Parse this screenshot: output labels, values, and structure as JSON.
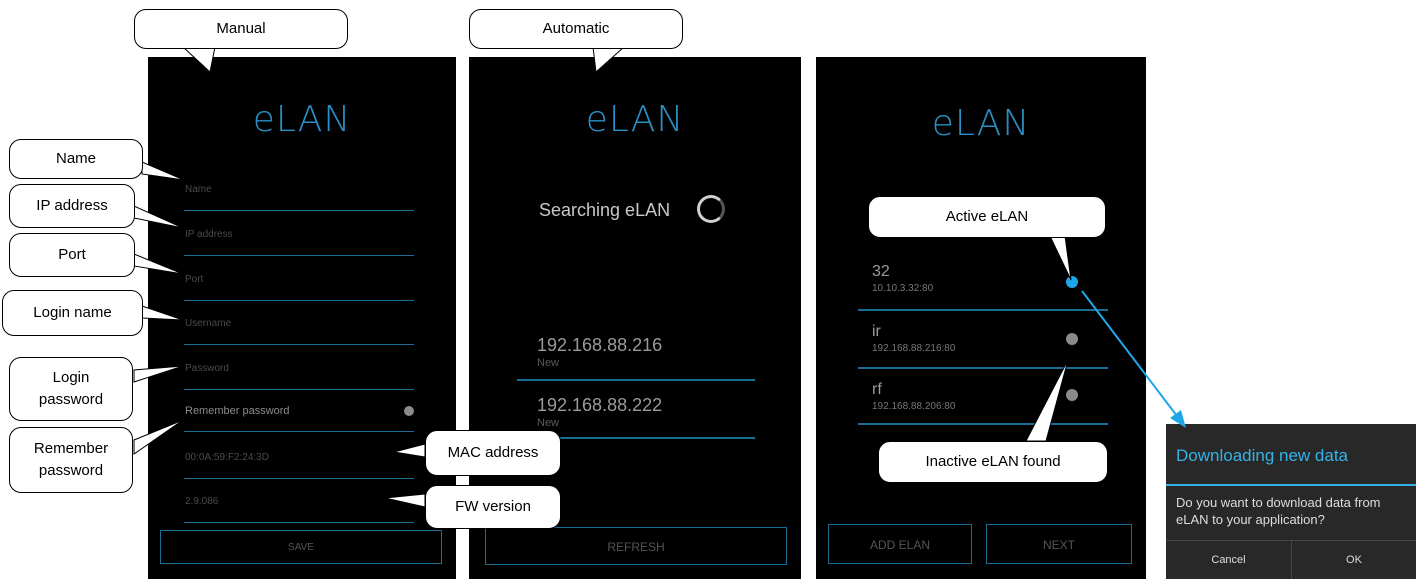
{
  "manual": {
    "logo": "eLAN",
    "fields": [
      "Name",
      "IP address",
      "Port",
      "Username",
      "Password"
    ],
    "remember_label": "Remember password",
    "mac_value": "00:0A:59:F2:24:3D",
    "fw_value": "2.9.086",
    "save_label": "SAVE"
  },
  "automatic": {
    "logo": "eLAN",
    "searching_text": "Searching eLAN",
    "results": [
      {
        "ip": "192.168.88.216",
        "status": "New"
      },
      {
        "ip": "192.168.88.222",
        "status": "New"
      }
    ],
    "refresh_label": "REFRESH"
  },
  "list": {
    "logo": "eLAN",
    "items": [
      {
        "name": "32",
        "address": "10.10.3.32:80",
        "active": true
      },
      {
        "name": "ir",
        "address": "192.168.88.216:80",
        "active": false
      },
      {
        "name": "rf",
        "address": "192.168.88.206:80",
        "active": false
      }
    ],
    "add_label": "ADD ELAN",
    "next_label": "NEXT"
  },
  "dialog": {
    "title": "Downloading new data",
    "message": "Do you want to download data from eLAN to your application?",
    "cancel_label": "Cancel",
    "ok_label": "OK"
  },
  "callouts": {
    "manual": "Manual",
    "automatic": "Automatic",
    "name": "Name",
    "ip": "IP address",
    "port": "Port",
    "login_name": "Login name",
    "login_password": "Login password",
    "remember_password": "Remember password",
    "mac": "MAC address",
    "fw": "FW version",
    "active": "Active eLAN",
    "inactive": "Inactive eLAN found"
  },
  "colors": {
    "accent": "#2a8fc4",
    "active_dot": "#1ea7e6",
    "inactive_dot": "#8a8a8a",
    "dialog_title": "#35b2e8"
  }
}
